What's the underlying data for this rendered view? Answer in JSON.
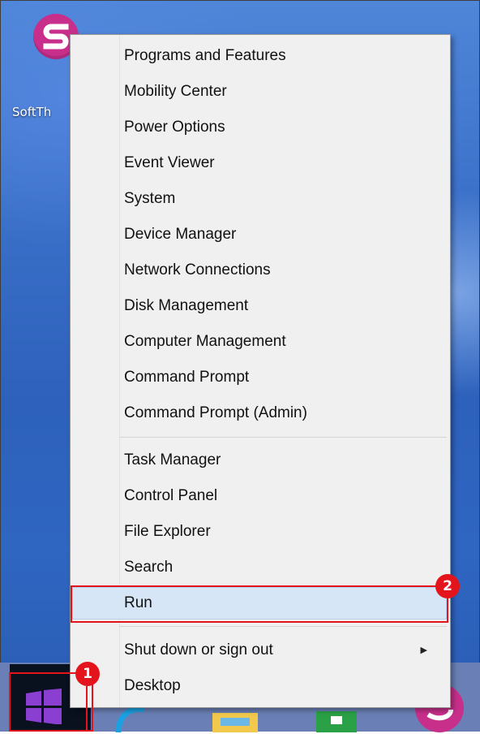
{
  "desktop": {
    "icon_label": "SoftTh",
    "icon_name": "softthing-s-icon"
  },
  "menu": {
    "groups": [
      [
        "Programs and Features",
        "Mobility Center",
        "Power Options",
        "Event Viewer",
        "System",
        "Device Manager",
        "Network Connections",
        "Disk Management",
        "Computer Management",
        "Command Prompt",
        "Command Prompt (Admin)"
      ],
      [
        "Task Manager",
        "Control Panel",
        "File Explorer",
        "Search",
        "Run"
      ],
      [
        "Shut down or sign out",
        "Desktop"
      ]
    ],
    "highlighted": "Run",
    "submenu_item": "Shut down or sign out"
  },
  "annotations": {
    "badge1": "1",
    "badge2": "2",
    "color": "#e3141b"
  },
  "taskbar": {
    "icons": [
      "windows-start-icon",
      "internet-explorer-icon",
      "file-explorer-icon",
      "store-icon",
      "softthing-app-icon"
    ]
  }
}
